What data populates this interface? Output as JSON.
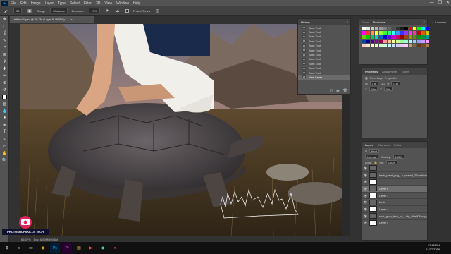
{
  "app": {
    "logo_text": "Ps",
    "menu": [
      "File",
      "Edit",
      "Image",
      "Layer",
      "Type",
      "Select",
      "Filter",
      "3D",
      "View",
      "Window",
      "Help"
    ],
    "window_controls": [
      "—",
      "❐",
      "✕"
    ]
  },
  "options_bar": {
    "brush_size": "30",
    "mode_label": "Range:",
    "mode_value": "Midtones",
    "exposure_label": "Exposure:",
    "exposure_value": "17%",
    "protect_label": "Protect Tones"
  },
  "document": {
    "tab_title": "Untitled-1.psd @ 66.7% (Layer 6, RGB/8) *",
    "close": "×"
  },
  "status": {
    "zoom": "66.67%",
    "doc_info": "Doc: 6.59M/390.6M"
  },
  "tools": [
    "move-icon",
    "marquee-icon",
    "lasso-icon",
    "quick-select-icon",
    "crop-icon",
    "frame-icon",
    "eyedropper-icon",
    "healing-icon",
    "brush-icon",
    "stamp-icon",
    "history-brush-icon",
    "eraser-icon",
    "gradient-icon",
    "blur-icon",
    "dodge-icon",
    "pen-icon",
    "type-icon",
    "path-select-icon",
    "rectangle-icon",
    "hand-icon",
    "zoom-icon"
  ],
  "tool_glyphs": [
    "✥",
    "⬚",
    "ʆ",
    "✎",
    "⌗",
    "⊠",
    "⚲",
    "✚",
    "✏",
    "⊕",
    "↺",
    "◫",
    "▤",
    "💧",
    "●",
    "✒",
    "T",
    "↖",
    "▭",
    "✋",
    "🔍"
  ],
  "history": {
    "tab": "History",
    "items": [
      "Burn Tool",
      "Burn Tool",
      "Burn Tool",
      "Burn Tool",
      "Burn Tool",
      "Burn Tool",
      "Burn Tool",
      "Burn Tool",
      "Burn Tool",
      "Burn Tool",
      "Burn Tool",
      "New Layer"
    ]
  },
  "swatches": {
    "tabs": [
      "Color",
      "Swatches"
    ],
    "libraries_label": "Libraries",
    "colors": [
      "#ffffff",
      "#e6e6e6",
      "#cccccc",
      "#b3b3b3",
      "#999999",
      "#808080",
      "#666666",
      "#4d4d4d",
      "#333333",
      "#1a1a1a",
      "#000000",
      "#ff0000",
      "#ffff00",
      "#00ff00",
      "#00ffff",
      "#0000ff",
      "#ff00ff",
      "#ff3333",
      "#ff9933",
      "#ffff33",
      "#99ff33",
      "#33ff33",
      "#33ff99",
      "#33ffff",
      "#3399ff",
      "#3333ff",
      "#9933ff",
      "#ff33ff",
      "#ff3399",
      "#cc0000",
      "#cc6600",
      "#cccc00",
      "#66cc00",
      "#00cc00",
      "#00cc66",
      "#00cccc",
      "#0066cc",
      "#0000cc",
      "#6600cc",
      "#cc00cc",
      "#cc0066",
      "#990000",
      "#994c00",
      "#999900",
      "#4c9900",
      "#009900",
      "#00994c",
      "#009999",
      "#004c99",
      "#000099",
      "#4c0099",
      "#990099",
      "#99004c",
      "#ff9999",
      "#ffcc99",
      "#ffff99",
      "#ccff99",
      "#99ff99",
      "#99ffcc",
      "#99ffff",
      "#99ccff",
      "#9999ff",
      "#cc99ff",
      "#ff99ff",
      "#ffcccc",
      "#ffe5cc",
      "#ffffcc",
      "#e5ffcc",
      "#ccffcc",
      "#ccffe5",
      "#ccffff",
      "#cce5ff",
      "#ccccff",
      "#e5ccff",
      "#ffccff",
      "#c69c6d",
      "#8c6239",
      "#603913",
      "#754c24",
      "#a67c52"
    ]
  },
  "properties": {
    "tabs": [
      "Properties",
      "Adjustments",
      "Styles"
    ],
    "title": "Pixel Layer Properties",
    "w_label": "W",
    "w_value": "0 in",
    "h_label": "H",
    "h_value": "0 in",
    "go_label": "GO",
    "x_label": "X",
    "x_value": "0 in",
    "y_label": "Y",
    "y_value": "0 in"
  },
  "layers": {
    "tabs": [
      "Layers",
      "Channels",
      "Paths"
    ],
    "kind_label": "Kind",
    "blend_mode": "Normal",
    "opacity_label": "Opacity:",
    "opacity_value": "100%",
    "lock_label": "Lock:",
    "fill_label": "Fill:",
    "fill_value": "100%",
    "items": [
      {
        "name": "",
        "thumb": "dark",
        "sel": false
      },
      {
        "name": "herb_plant_png_...updated_27me9m0",
        "thumb": "dark",
        "sel": false
      },
      {
        "name": "",
        "thumb": "mask",
        "sel": false
      },
      {
        "name": "Layer 6",
        "thumb": "dark",
        "sel": true
      },
      {
        "name": "Layer 3",
        "thumb": "mask",
        "sel": false
      },
      {
        "name": "turtle",
        "thumb": "dark",
        "sel": false
      },
      {
        "name": "Layer 4",
        "thumb": "mask",
        "sel": false
      },
      {
        "name": "rock_grop_free_to_...rify_d9e906 copy",
        "thumb": "dark",
        "sel": false
      },
      {
        "name": "Layer 5",
        "thumb": "mask",
        "sel": false
      }
    ]
  },
  "taskbar": {
    "icons": [
      "windows-icon",
      "search-icon",
      "task-view-icon",
      "chrome-icon",
      "photoshop-icon",
      "premiere-icon",
      "explorer-icon",
      "media-icon",
      "app-icon",
      "app2-icon"
    ],
    "glyphs": [
      "⊞",
      "○",
      "▭",
      "◉",
      "Ps",
      "Pr",
      "▤",
      "▶",
      "◆",
      "●"
    ],
    "time": "12:46 PM",
    "date": "11/27/2019"
  },
  "watermark": {
    "text": "PHOTOSHOPSKILLS TECH"
  },
  "colors": {
    "ui_dark": "#323232",
    "ui_panel": "#535353",
    "accent": "#31a8ff"
  }
}
